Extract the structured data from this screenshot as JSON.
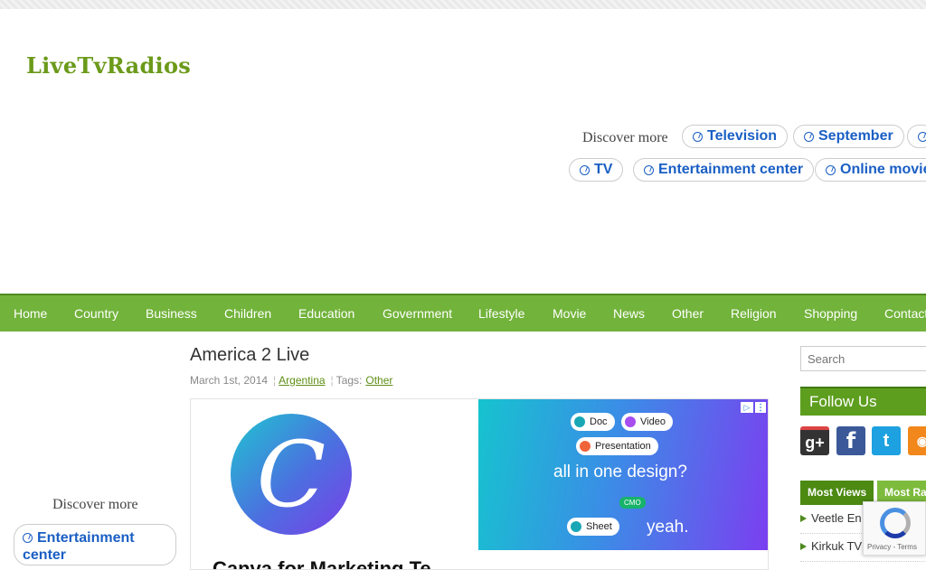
{
  "site": {
    "logo": "LiveTvRadios"
  },
  "discover_top": {
    "label": "Discover more",
    "pills": [
      "Television",
      "September",
      "",
      "TV",
      "Entertainment center",
      "Online movie"
    ]
  },
  "nav": [
    "Home",
    "Country",
    "Business",
    "Children",
    "Education",
    "Government",
    "Lifestyle",
    "Movie",
    "News",
    "Other",
    "Religion",
    "Shopping",
    "Contact"
  ],
  "post": {
    "title": "America 2 Live",
    "date": "March 1st, 2014",
    "category": "Argentina",
    "tags_label": "Tags:",
    "tag": "Other"
  },
  "ad": {
    "logo_letter": "C",
    "headline": "Canva for Marketing Te",
    "chip_doc": "Doc",
    "chip_video": "Video",
    "chip_presentation": "Presentation",
    "text1": "all in one design?",
    "chip_sheet": "Sheet",
    "text2": "yeah.",
    "cmo": "CMO",
    "adchoice": "▷",
    "menu": "⋮"
  },
  "left": {
    "discover_label": "Discover more",
    "pill": "Entertainment center"
  },
  "sidebar": {
    "search_placeholder": "Search",
    "follow_title": "Follow Us",
    "social": {
      "gplus": "g+",
      "facebook": "f",
      "twitter": "t",
      "rss": "◉"
    },
    "tabs": [
      "Most Views",
      "Most Ra"
    ],
    "list": [
      "Veetle En",
      "Kirkuk TV"
    ]
  },
  "recaptcha": {
    "text": "Privacy - Terms"
  },
  "colors": {
    "nav_green": "#72b33b",
    "link_blue": "#1a5fc4",
    "logo_green": "#6b9a1a"
  }
}
